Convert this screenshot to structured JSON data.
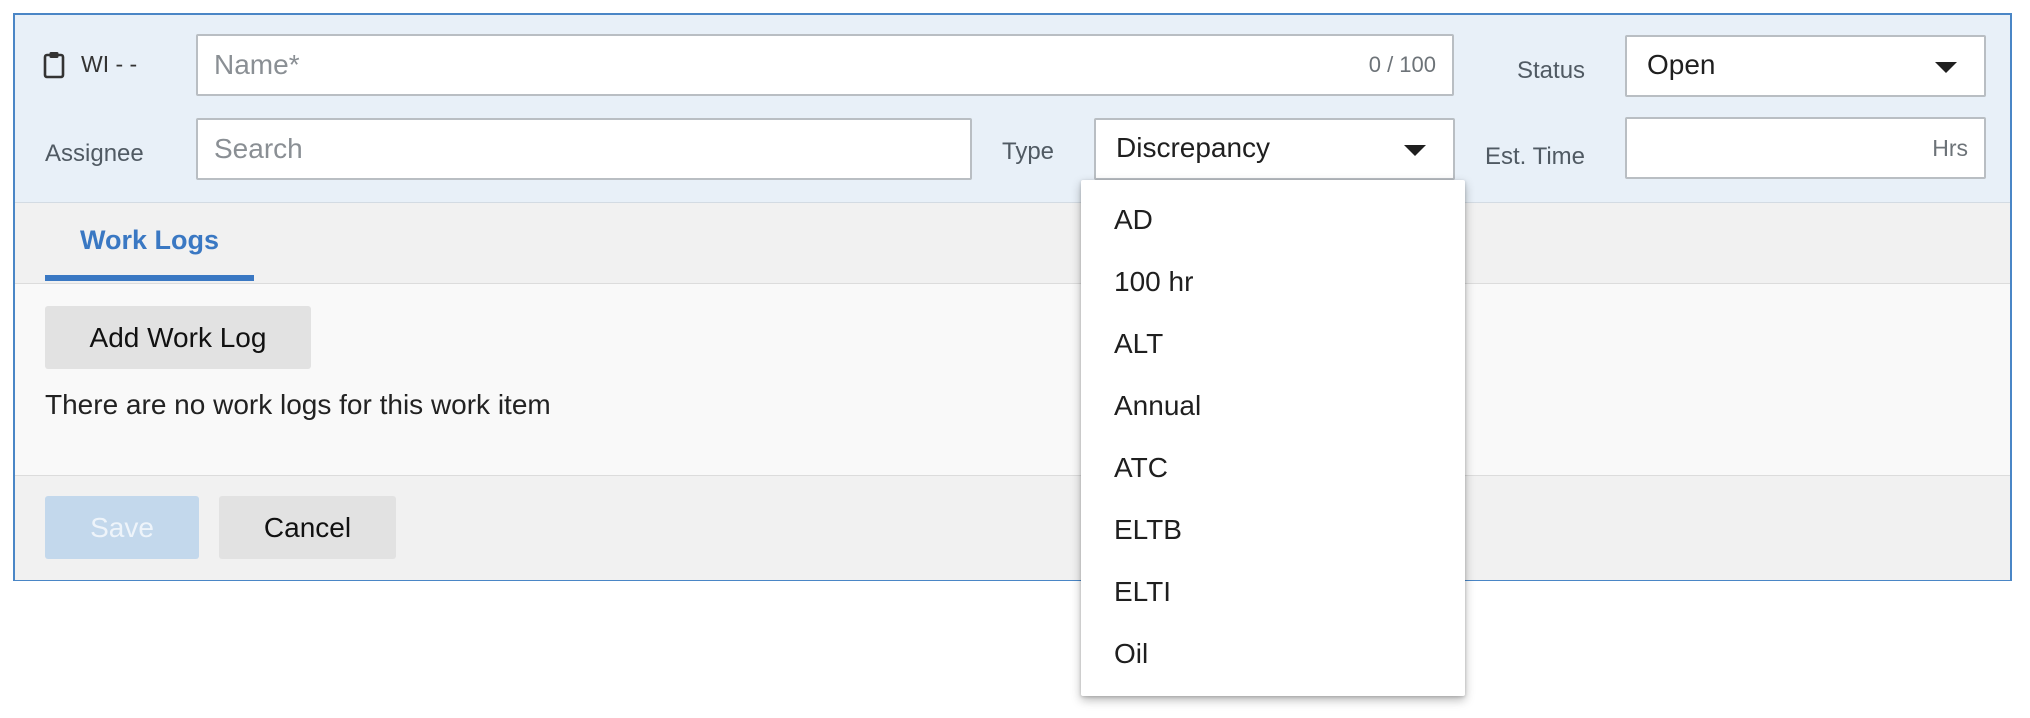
{
  "header": {
    "wi_label": "WI - -",
    "name_placeholder": "Name*",
    "name_counter": "0 / 100",
    "status_label": "Status",
    "status_value": "Open",
    "assignee_label": "Assignee",
    "assignee_placeholder": "Search",
    "type_label": "Type",
    "type_value": "Discrepancy",
    "est_time_label": "Est. Time",
    "est_time_unit": "Hrs"
  },
  "tabs": [
    {
      "label": "Work Logs",
      "active": true
    }
  ],
  "logs": {
    "add_button": "Add Work Log",
    "empty_message": "There are no work logs for this work item"
  },
  "footer": {
    "save_label": "Save",
    "cancel_label": "Cancel"
  },
  "type_dropdown": {
    "options": [
      "AD",
      "100 hr",
      "ALT",
      "Annual",
      "ATC",
      "ELTB",
      "ELTI",
      "Oil"
    ]
  },
  "colors": {
    "accent": "#3a78c3",
    "header_bg": "#e8f0f8",
    "card_border": "#4a86c6",
    "save_disabled_bg": "#c3d8ec"
  },
  "icons": {
    "work_item": "clipboard-icon",
    "dropdown": "caret-down-icon"
  }
}
